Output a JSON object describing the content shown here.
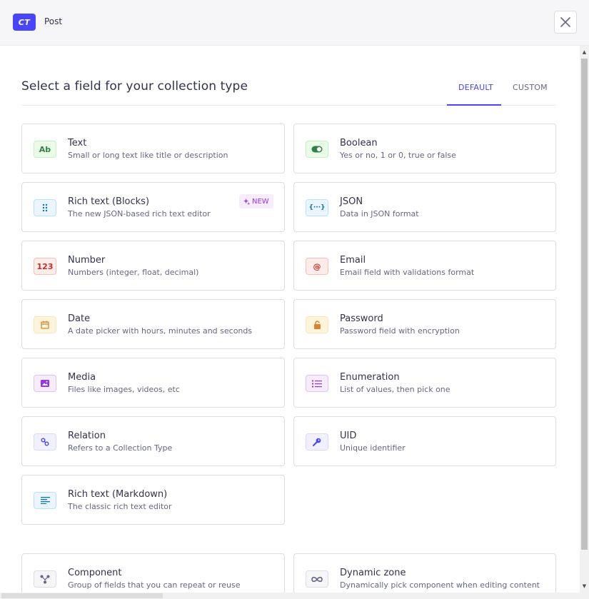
{
  "header": {
    "badge": "CT",
    "title": "Post"
  },
  "main": {
    "heading": "Select a field for your collection type",
    "tabs": [
      {
        "label": "DEFAULT"
      },
      {
        "label": "CUSTOM"
      }
    ]
  },
  "fields": [
    {
      "name": "Text",
      "desc": "Small or long text like title or description",
      "icon": "text-icon",
      "icon_text": "Ab",
      "color": "#328048",
      "bg": "#eafbe7",
      "border": "#c6f0c2"
    },
    {
      "name": "Boolean",
      "desc": "Yes or no, 1 or 0, true or false",
      "icon": "toggle-icon",
      "color": "#328048",
      "bg": "#eafbe7",
      "border": "#c6f0c2"
    },
    {
      "name": "Rich text (Blocks)",
      "desc": "The new JSON-based rich text editor",
      "icon": "blocks-icon",
      "badge": "NEW",
      "color": "#0c75af",
      "bg": "#eaf5ff",
      "border": "#b8e1ff"
    },
    {
      "name": "JSON",
      "desc": "Data in JSON format",
      "icon": "json-icon",
      "icon_text": "{···}",
      "color": "#0c75af",
      "bg": "#eaf5ff",
      "border": "#b8e1ff"
    },
    {
      "name": "Number",
      "desc": "Numbers (integer, float, decimal)",
      "icon": "number-icon",
      "icon_text": "123",
      "color": "#d02b20",
      "bg": "#fcecea",
      "border": "#f5c0b8"
    },
    {
      "name": "Email",
      "desc": "Email field with validations format",
      "icon": "email-icon",
      "icon_text": "@",
      "color": "#d02b20",
      "bg": "#fcecea",
      "border": "#f5c0b8"
    },
    {
      "name": "Date",
      "desc": "A date picker with hours, minutes and seconds",
      "icon": "calendar-icon",
      "color": "#d9822f",
      "bg": "#fdf4dc",
      "border": "#fae7b9"
    },
    {
      "name": "Password",
      "desc": "Password field with encryption",
      "icon": "lock-icon",
      "color": "#d9822f",
      "bg": "#fdf4dc",
      "border": "#fae7b9"
    },
    {
      "name": "Media",
      "desc": "Files like images, videos, etc",
      "icon": "image-icon",
      "color": "#9736e8",
      "bg": "#f6ecfc",
      "border": "#e0c1f4"
    },
    {
      "name": "Enumeration",
      "desc": "List of values, then pick one",
      "icon": "list-icon",
      "color": "#9736e8",
      "bg": "#f6ecfc",
      "border": "#e0c1f4"
    },
    {
      "name": "Relation",
      "desc": "Refers to a Collection Type",
      "icon": "relation-icon",
      "color": "#4945ff",
      "bg": "#f0f0ff",
      "border": "#d9d8ff"
    },
    {
      "name": "UID",
      "desc": "Unique identifier",
      "icon": "key-icon",
      "color": "#4945ff",
      "bg": "#f0f0ff",
      "border": "#d9d8ff"
    },
    {
      "name": "Rich text (Markdown)",
      "desc": "The classic rich text editor",
      "icon": "markdown-icon",
      "color": "#0c75af",
      "bg": "#eaf5ff",
      "border": "#b8e1ff"
    }
  ],
  "special": [
    {
      "name": "Component",
      "desc": "Group of fields that you can repeat or reuse",
      "icon": "component-icon",
      "color": "#666687",
      "bg": "#f6f6f9",
      "border": "#dcdce4"
    },
    {
      "name": "Dynamic zone",
      "desc": "Dynamically pick component when editing content",
      "icon": "infinity-icon",
      "color": "#666687",
      "bg": "#f6f6f9",
      "border": "#dcdce4"
    }
  ]
}
